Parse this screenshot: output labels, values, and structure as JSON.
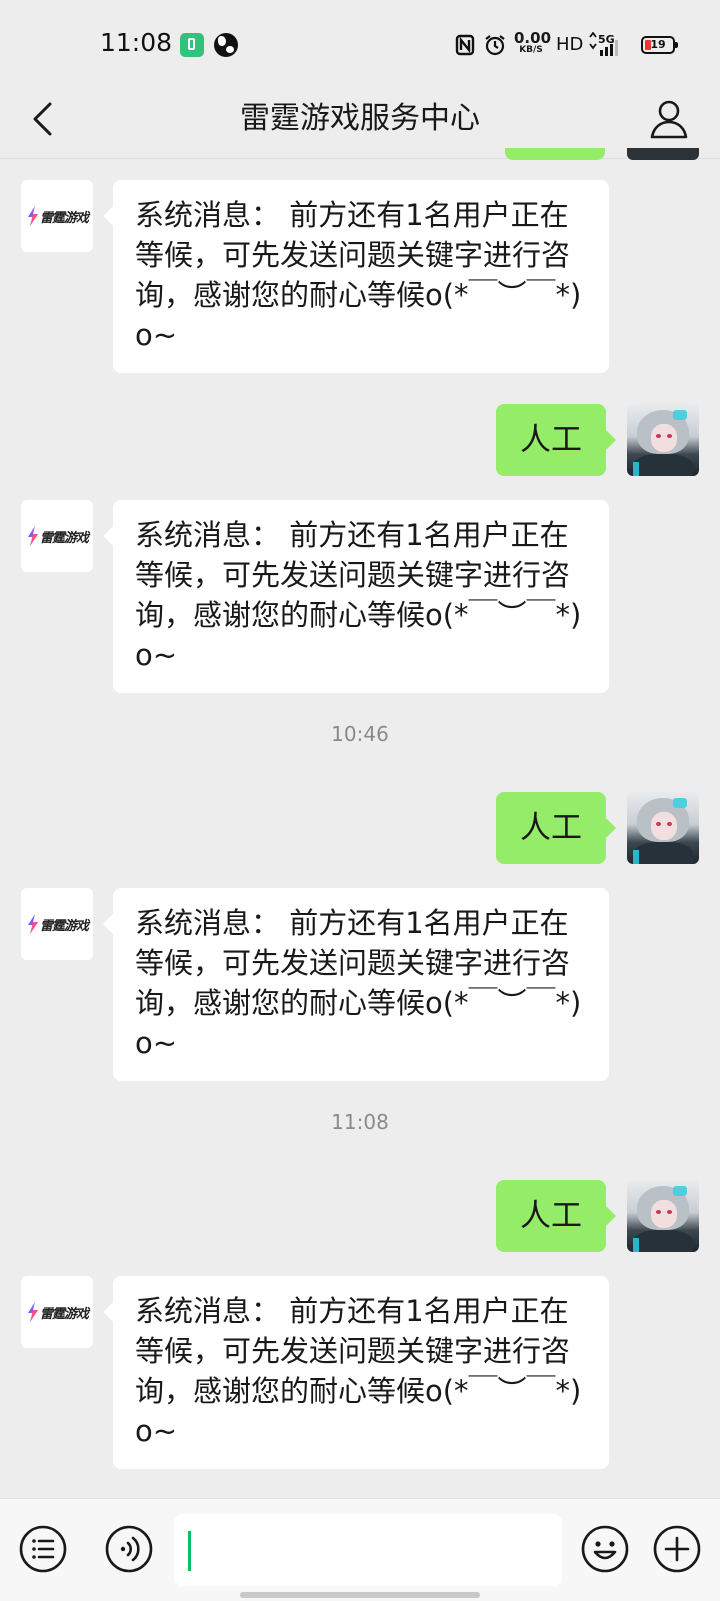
{
  "status_bar": {
    "time": "11:08",
    "net_speed_value": "0.00",
    "net_speed_unit": "KB/S",
    "hd_label": "HD",
    "signal_label": "5G",
    "battery_level": "19",
    "icons": [
      "battery-saver-icon",
      "globe-icon",
      "nfc-icon",
      "alarm-icon",
      "signal-icon",
      "battery-icon"
    ]
  },
  "header": {
    "title": "雷霆游戏服务中心",
    "back_icon": "chevron-left-icon",
    "profile_icon": "person-icon"
  },
  "bot": {
    "logo_text": "雷霆游戏",
    "system_message": "系统消息： 前方还有1名用户正在等候，可先发送问题关键字进行咨询，感谢您的耐心等候o(*￣︶￣*)o~"
  },
  "messages": [
    {
      "type": "in",
      "text": "系统消息： 前方还有1名用户正在等候，可先发送问题关键字进行咨询，感谢您的耐心等候o(*￣︶￣*)o~"
    },
    {
      "type": "out",
      "text": "人工"
    },
    {
      "type": "in",
      "text": "系统消息： 前方还有1名用户正在等候，可先发送问题关键字进行咨询，感谢您的耐心等候o(*￣︶￣*)o~"
    },
    {
      "type": "time",
      "text": "10:46"
    },
    {
      "type": "out",
      "text": "人工"
    },
    {
      "type": "in",
      "text": "系统消息： 前方还有1名用户正在等候，可先发送问题关键字进行咨询，感谢您的耐心等候o(*￣︶￣*)o~"
    },
    {
      "type": "time",
      "text": "11:08"
    },
    {
      "type": "out",
      "text": "人工"
    },
    {
      "type": "in",
      "text": "系统消息： 前方还有1名用户正在等候，可先发送问题关键字进行咨询，感谢您的耐心等候o(*￣︶￣*)o~"
    }
  ],
  "input_bar": {
    "input_value": "",
    "icons": [
      "menu-list-icon",
      "voice-icon",
      "emoji-icon",
      "plus-icon"
    ]
  },
  "colors": {
    "background": "#ededed",
    "outgoing_bubble": "#95ec69",
    "incoming_bubble": "#ffffff",
    "cursor": "#07c160",
    "battery_low": "#e53935"
  }
}
